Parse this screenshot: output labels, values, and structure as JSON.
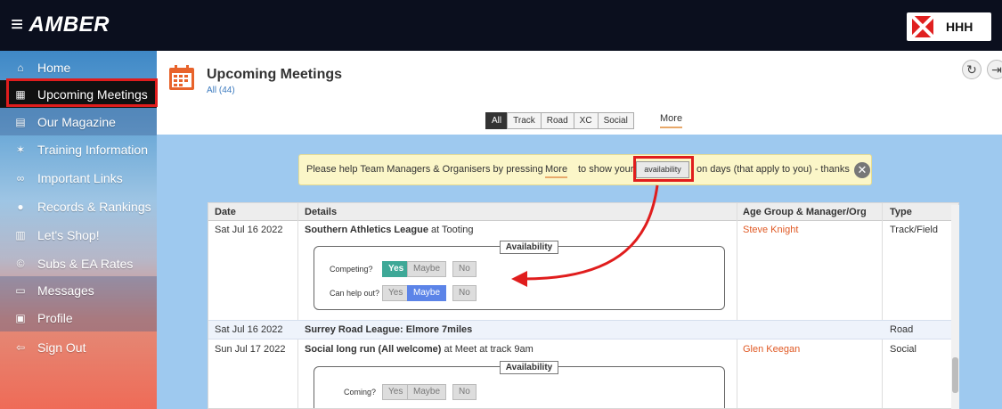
{
  "app": {
    "title": "AMBER",
    "menu_glyph": "≡",
    "club_name": "HHH"
  },
  "sidebar": {
    "items": [
      {
        "label": "Home",
        "icon": "home-icon",
        "glyph": "⌂"
      },
      {
        "label": "Upcoming Meetings",
        "icon": "calendar-icon",
        "glyph": "▦"
      },
      {
        "label": "Our Magazine",
        "icon": "magazine-icon",
        "glyph": "▤"
      },
      {
        "label": "Training Information",
        "icon": "runner-icon",
        "glyph": "✶"
      },
      {
        "label": "Important Links",
        "icon": "link-icon",
        "glyph": "∞"
      },
      {
        "label": "Records & Rankings",
        "icon": "trophy-icon",
        "glyph": "●"
      },
      {
        "label": "Let's Shop!",
        "icon": "shop-icon",
        "glyph": "▥"
      },
      {
        "label": "Subs & EA Rates",
        "icon": "coin-icon",
        "glyph": "©"
      },
      {
        "label": "Messages",
        "icon": "message-icon",
        "glyph": "▭"
      },
      {
        "label": "Profile",
        "icon": "profile-icon",
        "glyph": "▣"
      },
      {
        "label": "Sign Out",
        "icon": "signout-icon",
        "glyph": "⇦"
      }
    ]
  },
  "header": {
    "title": "Upcoming Meetings",
    "subtitle": "All (44)",
    "refresh_glyph": "↻",
    "export_glyph": "⇥"
  },
  "filters": {
    "options": [
      "All",
      "Track",
      "Road",
      "XC",
      "Social"
    ],
    "selected": "All",
    "more_label": "More"
  },
  "notice": {
    "text_before": "Please help Team Managers & Organisers by pressing",
    "more_label": "More",
    "text_middle": "to show your",
    "button_label": "availability",
    "text_after": "on days (that apply to you) - thanks",
    "close_glyph": "✕"
  },
  "table": {
    "headers": [
      "Date",
      "Details",
      "Age Group & Manager/Org",
      "Type"
    ],
    "rows": [
      {
        "date": "Sat Jul 16 2022",
        "title": "Southern Athletics League",
        "suffix": " at Tooting",
        "manager": "Steve Knight",
        "type": "Track/Field",
        "availability": {
          "label": "Availability",
          "questions": [
            {
              "q": "Competing?",
              "options": [
                "Yes",
                "Maybe",
                "No"
              ],
              "selected": "Yes"
            },
            {
              "q": "Can help out?",
              "options": [
                "Yes",
                "Maybe",
                "No"
              ],
              "selected": "Maybe"
            }
          ]
        }
      },
      {
        "date": "Sat Jul 16 2022",
        "title": "Surrey Road League: Elmore 7miles",
        "suffix": "",
        "manager": "",
        "type": "Road"
      },
      {
        "date": "Sun Jul 17 2022",
        "title": "Social long run (All welcome)",
        "suffix": " at Meet at track 9am",
        "manager": "Glen Keegan",
        "type": "Social",
        "availability": {
          "label": "Availability",
          "questions": [
            {
              "q": "Coming?",
              "options": [
                "Yes",
                "Maybe",
                "No"
              ],
              "selected": ""
            }
          ]
        }
      }
    ]
  },
  "colors": {
    "topbar": "#0b0f1e",
    "highlight_red": "#e01d1d",
    "yes_selected": "#3ea897",
    "maybe_selected": "#5c84e8",
    "manager_link": "#e05a25"
  }
}
